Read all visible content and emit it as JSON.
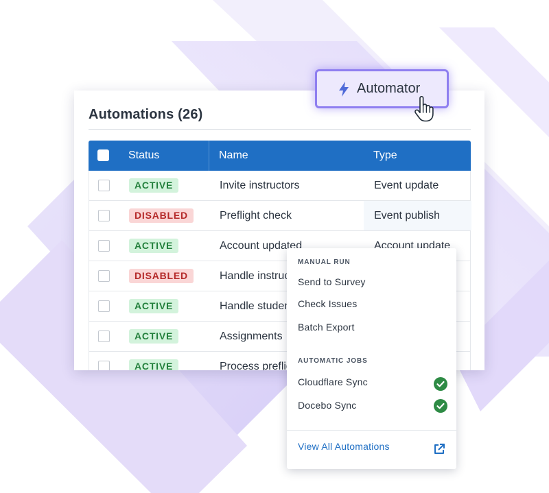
{
  "colors": {
    "table_header": "#1f6fc4",
    "active_bg": "#d3f3dc",
    "active_text": "#23803c",
    "disabled_bg": "#fad6d6",
    "disabled_text": "#b42828",
    "automator_border": "#8f7ff0",
    "automator_bg": "#ede9fd",
    "success_green": "#2e8b45",
    "link_blue": "#1f6fc4"
  },
  "automator_button": {
    "label": "Automator",
    "icon": "lightning-bolt-icon"
  },
  "card": {
    "title": "Automations (26)"
  },
  "table": {
    "columns": {
      "status": "Status",
      "name": "Name",
      "type": "Type"
    },
    "rows": [
      {
        "status": "ACTIVE",
        "name": "Invite instructors",
        "type": "Event update"
      },
      {
        "status": "DISABLED",
        "name": "Preflight check",
        "type": "Event publish"
      },
      {
        "status": "ACTIVE",
        "name": "Account updated",
        "type": "Account update"
      },
      {
        "status": "DISABLED",
        "name": "Handle instructor",
        "type": ""
      },
      {
        "status": "ACTIVE",
        "name": "Handle student",
        "type": ""
      },
      {
        "status": "ACTIVE",
        "name": "Assignments",
        "type": ""
      },
      {
        "status": "ACTIVE",
        "name": "Process preflight",
        "type": ""
      }
    ]
  },
  "menu": {
    "manual_run": {
      "title": "MANUAL RUN",
      "items": [
        "Send to Survey",
        "Check Issues",
        "Batch Export"
      ]
    },
    "automatic_jobs": {
      "title": "AUTOMATIC JOBS",
      "items": [
        "Cloudflare Sync",
        "Docebo Sync"
      ]
    },
    "view_all": "View All Automations",
    "view_all_icon": "external-link-icon"
  }
}
